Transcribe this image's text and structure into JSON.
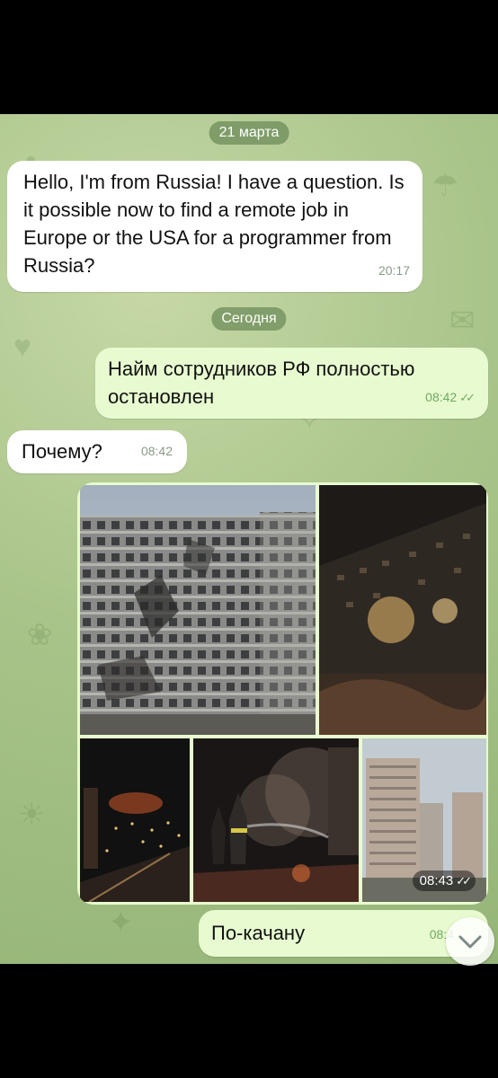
{
  "date_dividers": {
    "first": "21 марта",
    "second": "Сегодня"
  },
  "messages": [
    {
      "direction": "in",
      "text": "Hello, I'm from Russia! I have a question. Is it possible now to find a remote job in Europe or the USA for a programmer from Russia?",
      "time": "20:17"
    },
    {
      "direction": "out",
      "text": "Найм сотрудников РФ полностью остановлен",
      "time": "08:42",
      "status": "read"
    },
    {
      "direction": "in",
      "text": "Почему?",
      "time": "08:42"
    },
    {
      "direction": "out",
      "type": "photo_album",
      "photo_count": 5,
      "time": "08:43",
      "status": "read"
    },
    {
      "direction": "out",
      "text": "По-качану",
      "time": "08:4"
    }
  ],
  "icons": {
    "read_status": "double-check-icon",
    "scroll": "chevron-down-icon"
  },
  "colors": {
    "chat_background": "#a9c48a",
    "outgoing_bubble": "#e8fbd0",
    "incoming_bubble": "#ffffff",
    "date_pill": "#6e8c5a",
    "read_check": "#6fa862"
  }
}
